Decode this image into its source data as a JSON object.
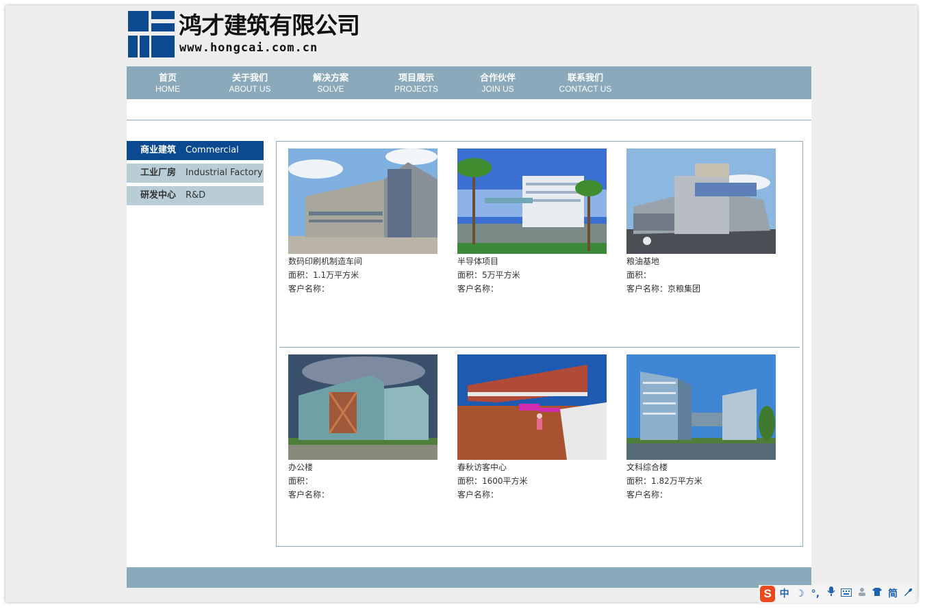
{
  "brand": {
    "name": "鸿才建筑有限公司",
    "url": "www.hongcai.com.cn",
    "color_primary": "#0b4a91"
  },
  "nav": {
    "items": [
      {
        "cn": "首页",
        "en": "HOME"
      },
      {
        "cn": "关于我们",
        "en": "ABOUT US"
      },
      {
        "cn": "解决方案",
        "en": "SOLVE"
      },
      {
        "cn": "项目展示",
        "en": "PROJECTS"
      },
      {
        "cn": "合作伙伴",
        "en": "JOIN US"
      },
      {
        "cn": "联系我们",
        "en": "CONTACT US"
      }
    ],
    "bg_color": "#8aa9ba"
  },
  "sidebar": {
    "items": [
      {
        "cn": "商业建筑",
        "en": "Commercial",
        "active": true
      },
      {
        "cn": "工业厂房",
        "en": "Industrial Factory",
        "active": false
      },
      {
        "cn": "研发中心",
        "en": "R&D",
        "active": false
      }
    ]
  },
  "projects": [
    {
      "title": "数码印刷机制造车间",
      "area": "面积：1.1万平方米",
      "client": "客户名称："
    },
    {
      "title": "半导体项目",
      "area": "面积：5万平方米",
      "client": "客户名称："
    },
    {
      "title": "粮油基地",
      "area": "面积：",
      "client": "客户名称：京粮集团"
    },
    {
      "title": "办公楼",
      "area": "面积：",
      "client": "客户名称："
    },
    {
      "title": "春秋访客中心",
      "area": "面积：1600平方米",
      "client": "客户名称："
    },
    {
      "title": "文科综合楼",
      "area": "面积：1.82万平方米",
      "client": "客户名称："
    }
  ],
  "ime": {
    "logo": "S",
    "buttons": [
      "中",
      "☽",
      "°,",
      "mic-icon",
      "keyboard-icon",
      "user-icon",
      "shirt-icon",
      "简",
      "wrench-icon"
    ]
  }
}
